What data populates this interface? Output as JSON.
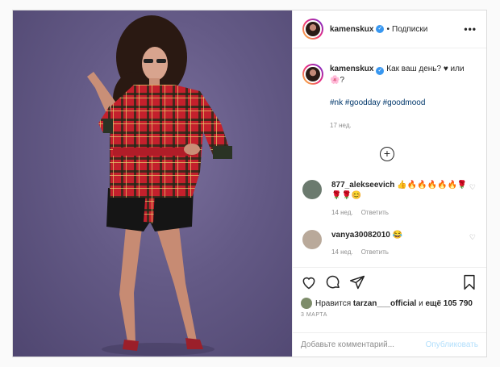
{
  "header": {
    "username": "kamenskux",
    "separator": "•",
    "follow_label": "Подписки",
    "more": "•••"
  },
  "caption": {
    "username": "kamenskux",
    "text": "Как ваш день? ♥ или 🌸?",
    "hashtags": "#nk #goodday #goodmood",
    "age": "17 нед."
  },
  "load_more": "+",
  "comments": [
    {
      "username": "877_alekseevich",
      "text": "👍🔥🔥🔥🔥🔥🌹🌹🌹😊",
      "age": "14 нед.",
      "reply": "Ответить"
    },
    {
      "username": "vanya30082010",
      "text": "😂",
      "age": "14 нед.",
      "reply": "Ответить"
    }
  ],
  "likes": {
    "prefix": "Нравится",
    "user": "tarzan___official",
    "middle": "и",
    "rest": "ещё 105 790"
  },
  "date": "3 МАРТА",
  "add_comment": {
    "placeholder": "Добавьте комментарий...",
    "publish": "Опубликовать"
  },
  "colors": {
    "link": "#00376b",
    "verified": "#3897f0",
    "publish_disabled": "#b2dffc"
  }
}
